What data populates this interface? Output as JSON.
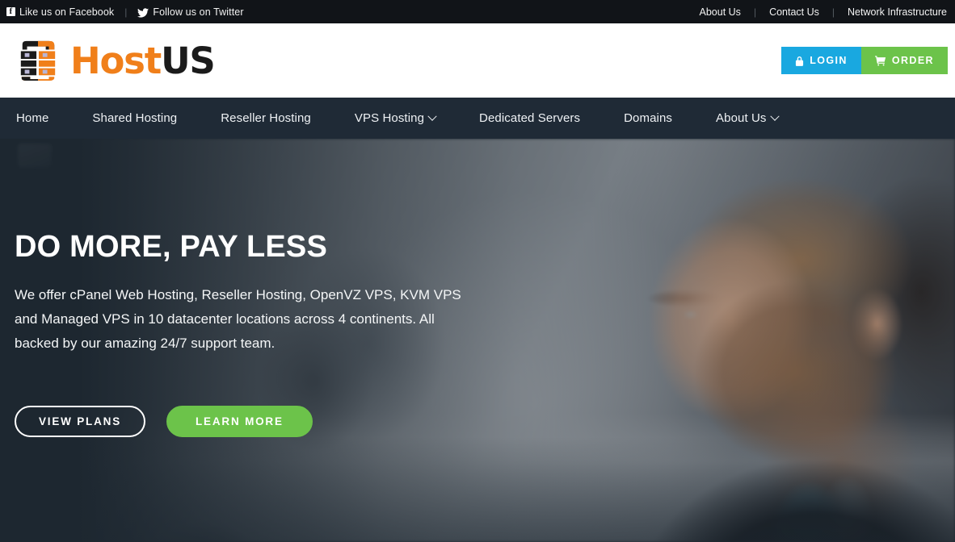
{
  "topbar": {
    "social": [
      {
        "icon": "facebook-icon",
        "label": "Like us on Facebook"
      },
      {
        "icon": "twitter-icon",
        "label": "Follow us on Twitter"
      }
    ],
    "separator": "|",
    "links": [
      {
        "label": "About Us"
      },
      {
        "label": "Contact Us"
      },
      {
        "label": "Network Infrastructure"
      }
    ],
    "background_color": "#111418"
  },
  "header": {
    "logo": {
      "icon": "server-rack-logo-icon",
      "text_primary": "Host",
      "text_secondary": "US",
      "primary_color": "#f07f1a",
      "secondary_color": "#1b1b1b"
    },
    "login_button": {
      "label": "LOGIN",
      "icon": "lock-icon",
      "color": "#19a8e0"
    },
    "order_button": {
      "label": "ORDER",
      "icon": "cart-icon",
      "color": "#6cc34a"
    }
  },
  "nav": {
    "background_color": "#1f2a36",
    "items": [
      {
        "label": "Home",
        "has_dropdown": false
      },
      {
        "label": "Shared Hosting",
        "has_dropdown": false
      },
      {
        "label": "Reseller Hosting",
        "has_dropdown": false
      },
      {
        "label": "VPS Hosting",
        "has_dropdown": true
      },
      {
        "label": "Dedicated Servers",
        "has_dropdown": false
      },
      {
        "label": "Domains",
        "has_dropdown": false
      },
      {
        "label": "About Us",
        "has_dropdown": true
      }
    ]
  },
  "hero": {
    "title": "DO MORE, PAY LESS",
    "subtitle": "We offer cPanel Web Hosting, Reseller Hosting, OpenVZ VPS, KVM VPS and Managed VPS in 10 datacenter locations across 4 continents. All backed by our amazing 24/7 support team.",
    "primary_button": {
      "label": "VIEW PLANS"
    },
    "secondary_button": {
      "label": "LEARN MORE",
      "color": "#6cc34a"
    },
    "overlay_color": "#1d2730",
    "background_description": "blurred office photo of a bearded man in profile wearing a light blue collared shirt and dark jacket"
  }
}
